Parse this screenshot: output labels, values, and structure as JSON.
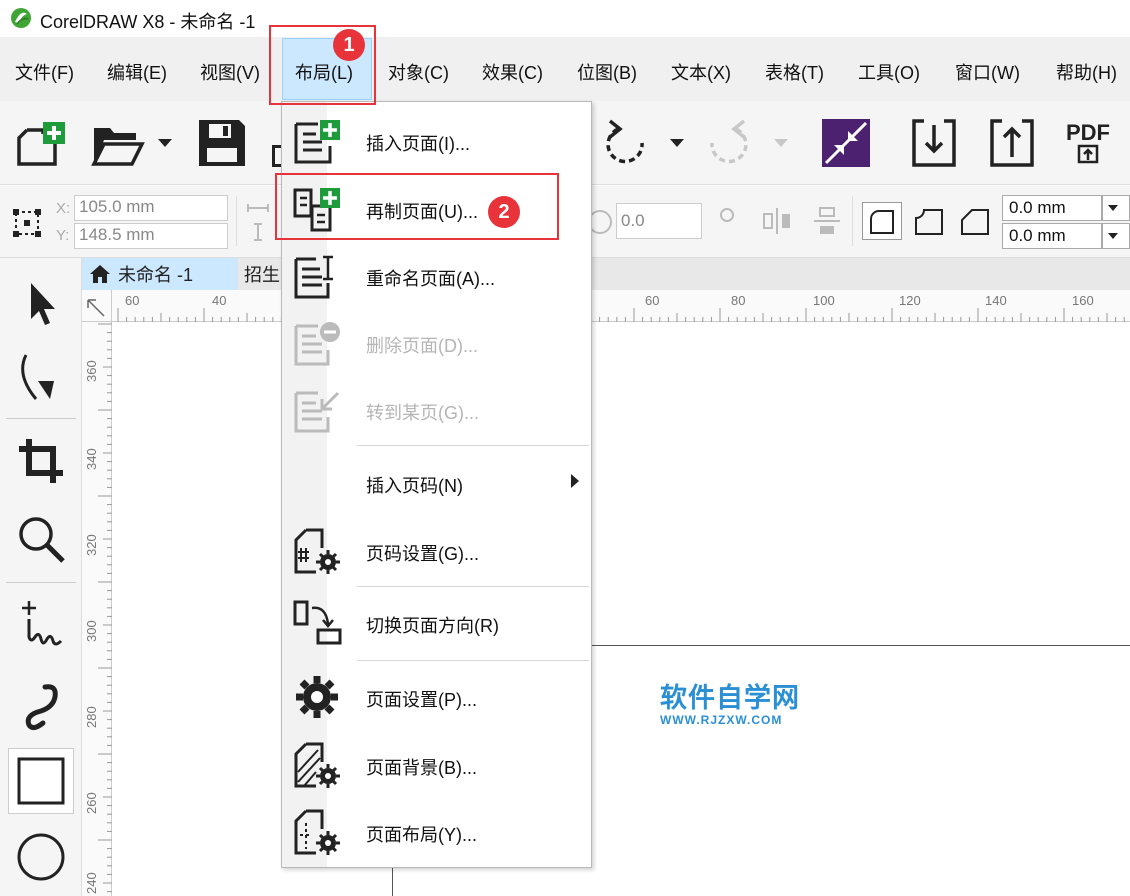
{
  "window": {
    "title": "CorelDRAW X8 - 未命名 -1"
  },
  "menubar": {
    "items": [
      {
        "label": "文件(F)"
      },
      {
        "label": "编辑(E)"
      },
      {
        "label": "视图(V)"
      },
      {
        "label": "布局(L)"
      },
      {
        "label": "对象(C)"
      },
      {
        "label": "效果(C)"
      },
      {
        "label": "位图(B)"
      },
      {
        "label": "文本(X)"
      },
      {
        "label": "表格(T)"
      },
      {
        "label": "工具(O)"
      },
      {
        "label": "窗口(W)"
      },
      {
        "label": "帮助(H)"
      }
    ],
    "active": "布局(L)"
  },
  "toolbar": {
    "pdf_label": "PDF"
  },
  "propbar": {
    "x_label": "X:",
    "y_label": "Y:",
    "x_value": "105.0 mm",
    "y_value": "148.5 mm",
    "angle_value": "0.0",
    "mm_top": "0.0 mm",
    "mm_bottom": "0.0 mm"
  },
  "doc_tabs": [
    {
      "label": "未命名 -1"
    },
    {
      "label": "招生"
    }
  ],
  "ruler": {
    "h_labels": [
      "60",
      "40",
      "60",
      "80",
      "100",
      "120",
      "140",
      "160"
    ],
    "v_labels": [
      "360",
      "340",
      "320",
      "300",
      "280",
      "260",
      "240"
    ]
  },
  "dropdown": {
    "items": [
      {
        "label": "插入页面(I)...",
        "enabled": true,
        "icon": "insert-page-icon"
      },
      {
        "label": "再制页面(U)...",
        "enabled": true,
        "icon": "duplicate-page-icon"
      },
      {
        "label": "重命名页面(A)...",
        "enabled": true,
        "icon": "rename-page-icon"
      },
      {
        "label": "删除页面(D)...",
        "enabled": false,
        "icon": "delete-page-icon"
      },
      {
        "label": "转到某页(G)...",
        "enabled": false,
        "icon": "goto-page-icon"
      },
      {
        "label": "插入页码(N)",
        "enabled": true,
        "icon": "",
        "submenu": true
      },
      {
        "label": "页码设置(G)...",
        "enabled": true,
        "icon": "page-number-settings-icon"
      },
      {
        "label": "切换页面方向(R)",
        "enabled": true,
        "icon": "switch-orientation-icon"
      },
      {
        "label": "页面设置(P)...",
        "enabled": true,
        "icon": "gear-icon"
      },
      {
        "label": "页面背景(B)...",
        "enabled": true,
        "icon": "page-background-icon"
      },
      {
        "label": "页面布局(Y)...",
        "enabled": true,
        "icon": "page-layout-icon"
      }
    ]
  },
  "annotations": {
    "badge1": "1",
    "badge2": "2"
  },
  "watermark": {
    "main": "软件自学网",
    "sub": "WWW.RJZXW.COM"
  },
  "colors": {
    "accent_red": "#e8333a",
    "menu_highlight": "#cce8ff",
    "watermark_blue": "#2b8fd6"
  }
}
